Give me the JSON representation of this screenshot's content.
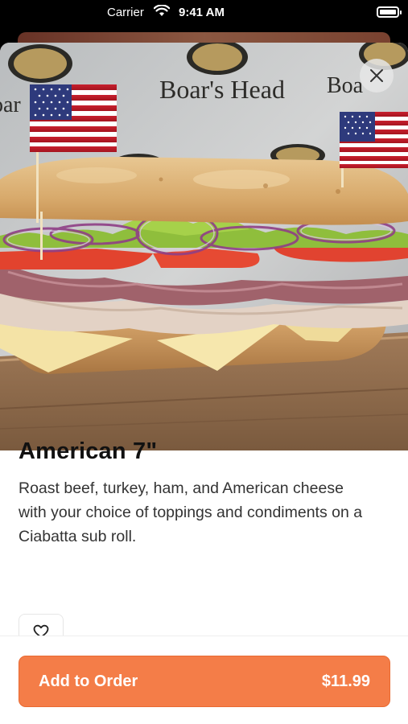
{
  "status_bar": {
    "carrier": "Carrier",
    "time": "9:41 AM"
  },
  "hero": {
    "sign_text": "Boar's Head",
    "image_subject": "sandwich-photo"
  },
  "item": {
    "title": "American 7\"",
    "description": "Roast beef, turkey, ham, and American cheese with your choice of toppings and condiments on a Ciabatta sub roll."
  },
  "footer": {
    "add_label": "Add to Order",
    "price": "$11.99"
  },
  "colors": {
    "accent": "#f47d48",
    "title": "#111111",
    "body_text": "#333333"
  }
}
